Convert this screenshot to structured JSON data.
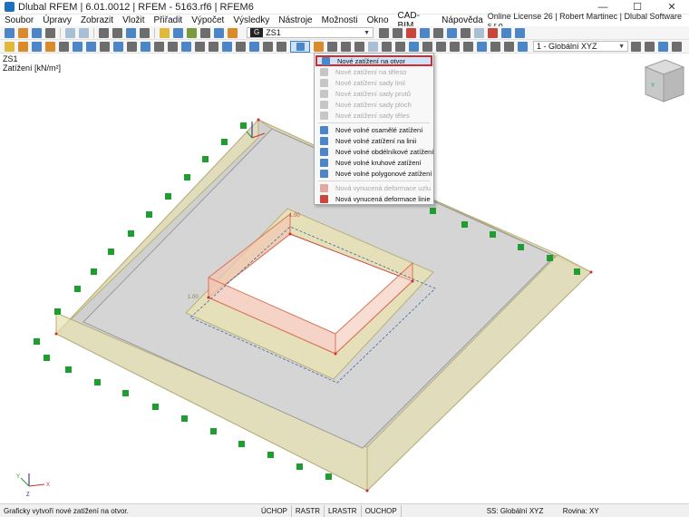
{
  "window": {
    "title": "Dlubal RFEM | 6.01.0012 | RFEM - 5163.rf6 | RFEM6",
    "minimize": "—",
    "maximize": "☐",
    "close": "✕"
  },
  "menu": {
    "items": [
      "Soubor",
      "Úpravy",
      "Zobrazit",
      "Vložit",
      "Přiřadit",
      "Výpočet",
      "Výsledky",
      "Nástroje",
      "Možnosti",
      "Okno",
      "CAD-BIM",
      "Nápověda"
    ],
    "license": "Online License 26 | Robert Martinec | Dlubal Software s.r.o."
  },
  "toolbar": {
    "load_case_tag": "G",
    "load_case_name": "ZS1",
    "coord_system": "1 - Globální XYZ",
    "icons": {
      "row1_left": [
        "new-icon",
        "open-icon",
        "save-icon",
        "print-icon",
        "undo-icon",
        "redo-icon"
      ],
      "active_tool": "opening-load-icon"
    }
  },
  "viewport": {
    "load_case": "ZS1",
    "load_label": "Zatížení [kN/m²]",
    "load_value_inner": "1.00",
    "load_value_side": "1.00",
    "axis_x": "X",
    "axis_y": "Y",
    "axis_z": "Z"
  },
  "dropdown": {
    "items": [
      {
        "label": "Nové zatížení na otvor",
        "state": "selected",
        "icon": "opening-load-icon",
        "color": "#4d86c6"
      },
      {
        "label": "Nové zatížení na těleso",
        "state": "disabled",
        "icon": "solid-load-icon",
        "color": "#8a8a8a"
      },
      {
        "label": "Nové zatížení sady linií",
        "state": "disabled",
        "icon": "line-set-load-icon",
        "color": "#8a8a8a"
      },
      {
        "label": "Nové zatížení sady prutů",
        "state": "disabled",
        "icon": "member-set-load-icon",
        "color": "#8a8a8a"
      },
      {
        "label": "Nové zatížení sady ploch",
        "state": "disabled",
        "icon": "surface-set-load-icon",
        "color": "#8a8a8a"
      },
      {
        "label": "Nové zatížení sady těles",
        "state": "disabled",
        "icon": "solid-set-load-icon",
        "color": "#8a8a8a"
      },
      {
        "label": "Nové volné osamělé zatížení",
        "state": "enabled",
        "icon": "free-concentrated-load-icon",
        "color": "#4d86c6"
      },
      {
        "label": "Nové volné zatížení na linii",
        "state": "enabled",
        "icon": "free-line-load-icon",
        "color": "#4d86c6"
      },
      {
        "label": "Nové volné obdélníkové zatížení",
        "state": "enabled",
        "icon": "free-rectangular-load-icon",
        "color": "#4d86c6"
      },
      {
        "label": "Nové volné kruhové zatížení",
        "state": "enabled",
        "icon": "free-circular-load-icon",
        "color": "#4d86c6"
      },
      {
        "label": "Nové volné polygonové zatížení",
        "state": "enabled",
        "icon": "free-polygon-load-icon",
        "color": "#4d86c6"
      },
      {
        "label": "Nová vynucená deformace uzlu",
        "state": "disabled",
        "icon": "imposed-node-deformation-icon",
        "color": "#c9463d"
      },
      {
        "label": "Nová vynucená deformace linie",
        "state": "enabled",
        "icon": "imposed-line-deformation-icon",
        "color": "#c9463d"
      }
    ]
  },
  "status": {
    "message": "Graficky vytvoří nové zatížení na otvor.",
    "buttons": [
      "ÚCHOP",
      "RASTR",
      "LRASTR",
      "OUCHOP"
    ],
    "cs": "SS: Globální XYZ",
    "plane": "Rovina: XY"
  },
  "colors": {
    "slab": "#d0d0d0",
    "wall": "#e8e2b4",
    "load_inner": "#f2c6b4",
    "support": "#1f9e2f",
    "highlight": "#d32b2b",
    "selected_bg": "#cde3f8"
  }
}
